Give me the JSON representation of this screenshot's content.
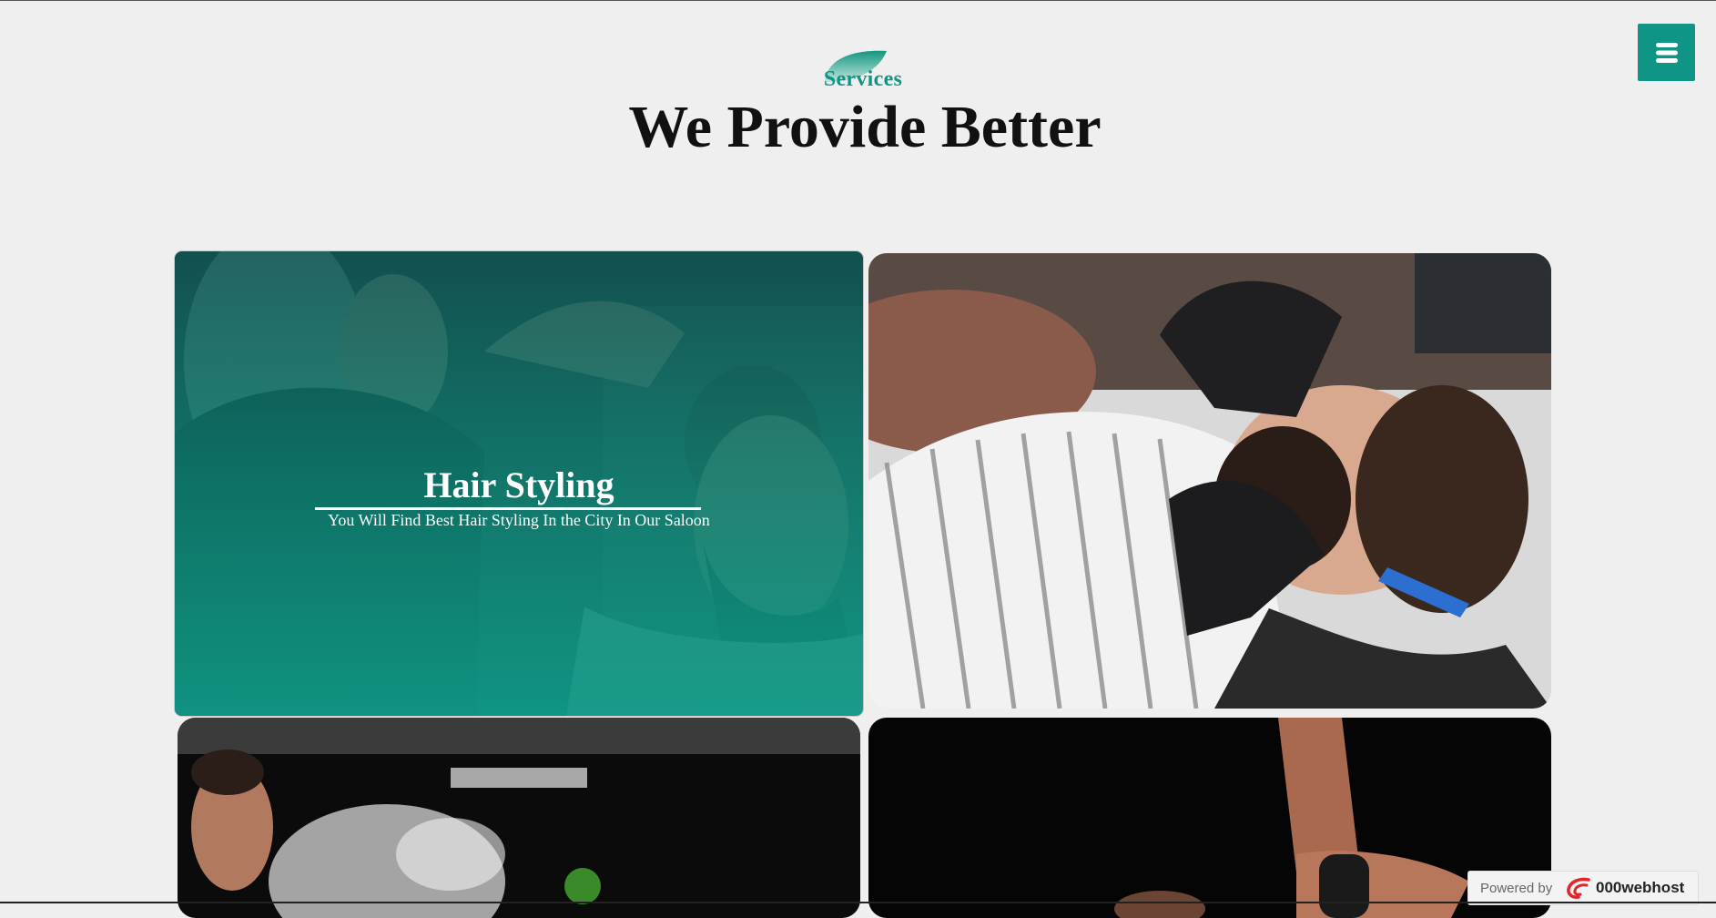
{
  "header": {
    "menu_icon": "hamburger-icon",
    "eyebrow": "Services",
    "title": "We Provide Better"
  },
  "services": [
    {
      "title": "Hair Styling",
      "description": "You Will Find Best Hair Styling In the City In Our Saloon",
      "photo": "stylist cutting a man's hair with scissors"
    },
    {
      "photo": "barber shaving a bearded man with a straight razor"
    },
    {
      "photo": "barber spraying water mist on client's hair"
    },
    {
      "photo": "hands holding a spray bottle over a client"
    }
  ],
  "badge": {
    "prefix": "Powered by",
    "brand": "000webhost"
  },
  "colors": {
    "accent": "#0f9585",
    "background": "#efefef",
    "title": "#111111"
  }
}
